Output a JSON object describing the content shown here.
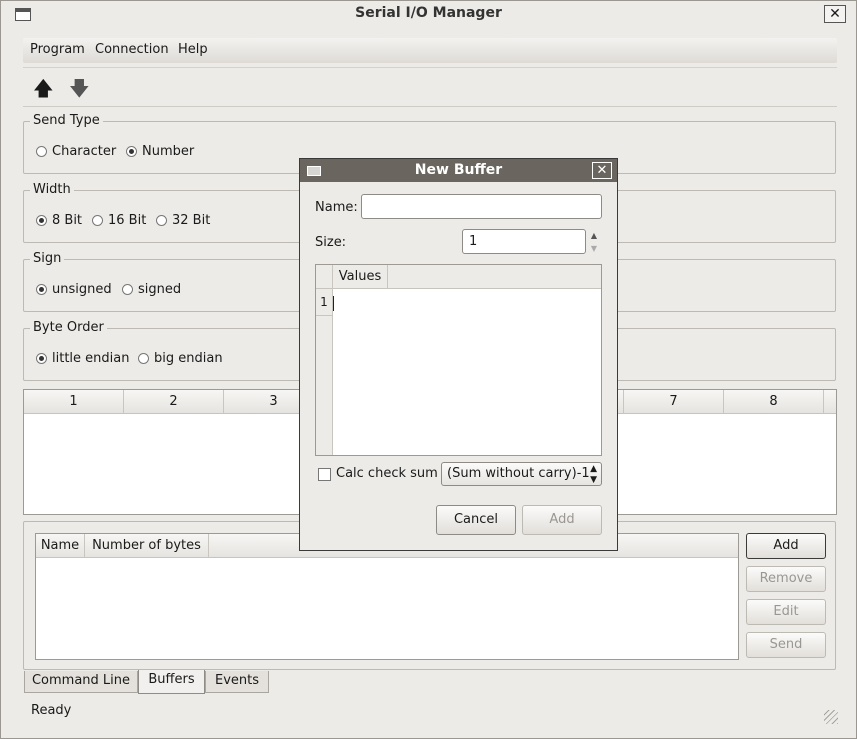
{
  "window": {
    "title": "Serial I/O Manager",
    "close_glyph": "✕"
  },
  "menu": {
    "program": "Program",
    "connection": "Connection",
    "help": "Help"
  },
  "toolbar": {
    "up_icon": "arrow-up-icon",
    "down_icon": "arrow-down-icon"
  },
  "send_type": {
    "label": "Send Type",
    "options": [
      "Character",
      "Number"
    ],
    "selected": "Number"
  },
  "width": {
    "label": "Width",
    "options": [
      "8 Bit",
      "16 Bit",
      "32 Bit"
    ],
    "selected": "8 Bit"
  },
  "sign": {
    "label": "Sign",
    "options": [
      "unsigned",
      "signed"
    ],
    "selected": "unsigned"
  },
  "byte_order": {
    "label": "Byte Order",
    "options": [
      "little endian",
      "big endian"
    ],
    "selected": "little endian"
  },
  "byte_table": {
    "columns": [
      "1",
      "2",
      "3",
      "7",
      "8"
    ]
  },
  "buffers_table": {
    "columns": [
      "Name",
      "Number of bytes"
    ]
  },
  "buffer_buttons": {
    "add": "Add",
    "remove": "Remove",
    "edit": "Edit",
    "send": "Send"
  },
  "tabs": [
    "Command Line",
    "Buffers",
    "Events"
  ],
  "active_tab": "Buffers",
  "status": "Ready",
  "dialog": {
    "title": "New Buffer",
    "close_glyph": "✕",
    "name_label": "Name:",
    "name_value": "",
    "size_label": "Size:",
    "size_value": "1",
    "values_header": "Values",
    "row_number": "1",
    "checksum_label": "Calc check sum",
    "checksum_method": "(Sum without carry)-1",
    "cancel": "Cancel",
    "add": "Add"
  }
}
